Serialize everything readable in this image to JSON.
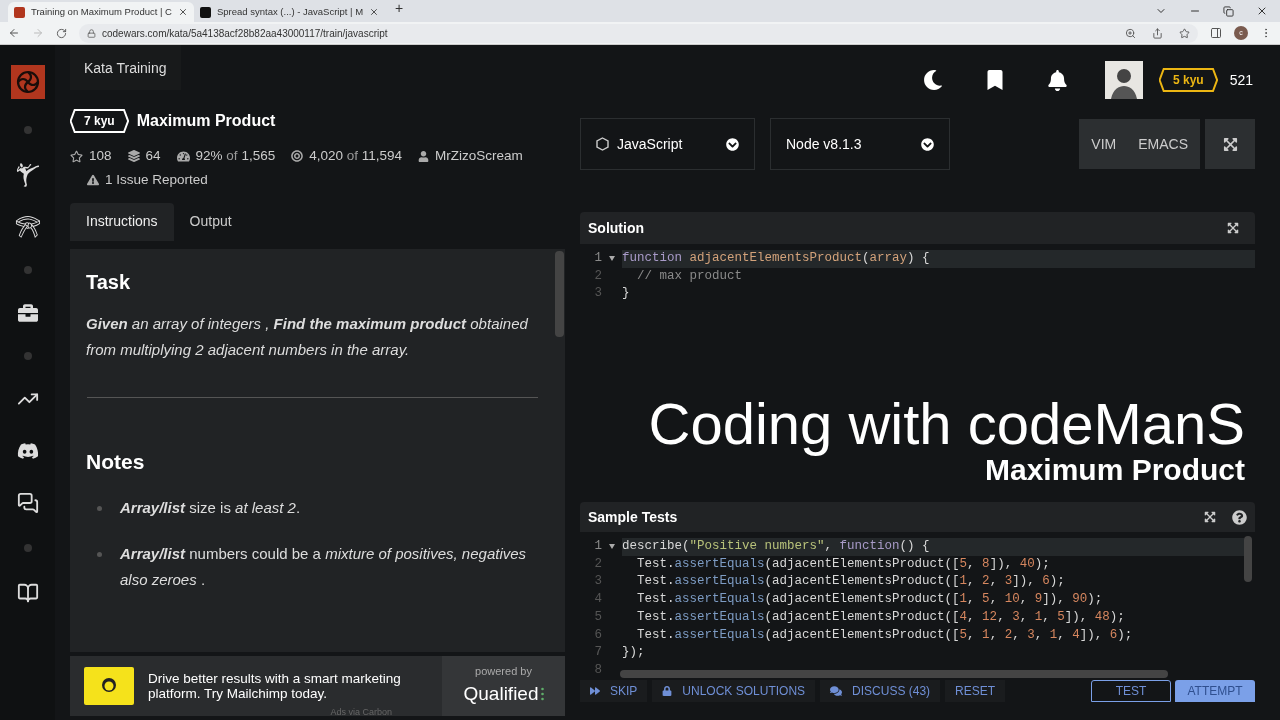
{
  "browser": {
    "tabs": [
      {
        "title": "Training on Maximum Product | C",
        "selected": true
      },
      {
        "title": "Spread syntax (...) - JavaScript | M",
        "selected": false
      }
    ],
    "new_tab": "+",
    "url": "codewars.com/kata/5a4138acf28b82aa43000117/train/javascript",
    "profile_initial": "c"
  },
  "header": {
    "section": "Kata Training",
    "rank": "5 kyu",
    "honor": "521"
  },
  "kata": {
    "rank": "7 kyu",
    "title": "Maximum Product",
    "stars": "108",
    "collections": "64",
    "satisfaction": "92%",
    "satisfaction_of": "of",
    "votes": "1,565",
    "completed": "4,020",
    "completed_of": "of",
    "attempts": "11,594",
    "author": "MrZizoScream",
    "issues": "1 Issue Reported"
  },
  "tabs": [
    {
      "label": "Instructions",
      "selected": true
    },
    {
      "label": "Output",
      "selected": false
    }
  ],
  "description": {
    "task_heading": "Task",
    "task_text": "**Given** an array of integers , **Find the maximum product** obtained from multiplying 2 adjacent numbers in the array.",
    "notes_heading": "Notes",
    "notes": [
      "**Array/list** size is *at least 2*.",
      "**Array/list** numbers could be a *mixture of positives, negatives also zeroes* ."
    ]
  },
  "ad": {
    "text": "Drive better results with a smart marketing platform. Try Mailchimp today.",
    "credit": "Ads via Carbon",
    "powered_by": "powered by",
    "platform": "Qualified"
  },
  "editor": {
    "language": "JavaScript",
    "version": "Node v8.1.3",
    "modes": [
      "VIM",
      "EMACS"
    ]
  },
  "solution": {
    "title": "Solution",
    "lines": [
      {
        "n": "1",
        "fold": true,
        "active": true,
        "tokens": [
          {
            "kind": "kw",
            "t": "function "
          },
          {
            "kind": "fn",
            "t": "adjacentElementsProduct"
          },
          {
            "kind": "plain",
            "t": "("
          },
          {
            "kind": "fn",
            "t": "array"
          },
          {
            "kind": "plain",
            "t": ") {"
          }
        ]
      },
      {
        "n": "2",
        "fold": false,
        "active": false,
        "tokens": [
          {
            "kind": "comment",
            "t": "  // max product"
          }
        ]
      },
      {
        "n": "3",
        "fold": false,
        "active": false,
        "tokens": [
          {
            "kind": "plain",
            "t": "}"
          }
        ]
      }
    ]
  },
  "overlay": {
    "title": "Coding with codeManS",
    "subtitle": "Maximum Product"
  },
  "tests": {
    "title": "Sample Tests",
    "lines": [
      {
        "n": "1",
        "fold": true,
        "active": true,
        "tokens": [
          {
            "kind": "plain",
            "t": "describe("
          },
          {
            "kind": "str",
            "t": "\"Positive numbers\""
          },
          {
            "kind": "plain",
            "t": ", "
          },
          {
            "kind": "kw",
            "t": "function"
          },
          {
            "kind": "plain",
            "t": "() {"
          }
        ]
      },
      {
        "n": "2",
        "fold": false,
        "active": false,
        "tokens": [
          {
            "kind": "plain",
            "t": "  Test."
          },
          {
            "kind": "method",
            "t": "assertEquals"
          },
          {
            "kind": "plain",
            "t": "(adjacentElementsProduct(["
          },
          {
            "kind": "num",
            "t": "5"
          },
          {
            "kind": "plain",
            "t": ", "
          },
          {
            "kind": "num",
            "t": "8"
          },
          {
            "kind": "plain",
            "t": "]), "
          },
          {
            "kind": "num",
            "t": "40"
          },
          {
            "kind": "plain",
            "t": ");"
          }
        ]
      },
      {
        "n": "3",
        "fold": false,
        "active": false,
        "tokens": [
          {
            "kind": "plain",
            "t": "  Test."
          },
          {
            "kind": "method",
            "t": "assertEquals"
          },
          {
            "kind": "plain",
            "t": "(adjacentElementsProduct(["
          },
          {
            "kind": "num",
            "t": "1"
          },
          {
            "kind": "plain",
            "t": ", "
          },
          {
            "kind": "num",
            "t": "2"
          },
          {
            "kind": "plain",
            "t": ", "
          },
          {
            "kind": "num",
            "t": "3"
          },
          {
            "kind": "plain",
            "t": "]), "
          },
          {
            "kind": "num",
            "t": "6"
          },
          {
            "kind": "plain",
            "t": ");"
          }
        ]
      },
      {
        "n": "4",
        "fold": false,
        "active": false,
        "tokens": [
          {
            "kind": "plain",
            "t": "  Test."
          },
          {
            "kind": "method",
            "t": "assertEquals"
          },
          {
            "kind": "plain",
            "t": "(adjacentElementsProduct(["
          },
          {
            "kind": "num",
            "t": "1"
          },
          {
            "kind": "plain",
            "t": ", "
          },
          {
            "kind": "num",
            "t": "5"
          },
          {
            "kind": "plain",
            "t": ", "
          },
          {
            "kind": "num",
            "t": "10"
          },
          {
            "kind": "plain",
            "t": ", "
          },
          {
            "kind": "num",
            "t": "9"
          },
          {
            "kind": "plain",
            "t": "]), "
          },
          {
            "kind": "num",
            "t": "90"
          },
          {
            "kind": "plain",
            "t": ");"
          }
        ]
      },
      {
        "n": "5",
        "fold": false,
        "active": false,
        "tokens": [
          {
            "kind": "plain",
            "t": "  Test."
          },
          {
            "kind": "method",
            "t": "assertEquals"
          },
          {
            "kind": "plain",
            "t": "(adjacentElementsProduct(["
          },
          {
            "kind": "num",
            "t": "4"
          },
          {
            "kind": "plain",
            "t": ", "
          },
          {
            "kind": "num",
            "t": "12"
          },
          {
            "kind": "plain",
            "t": ", "
          },
          {
            "kind": "num",
            "t": "3"
          },
          {
            "kind": "plain",
            "t": ", "
          },
          {
            "kind": "num",
            "t": "1"
          },
          {
            "kind": "plain",
            "t": ", "
          },
          {
            "kind": "num",
            "t": "5"
          },
          {
            "kind": "plain",
            "t": "]), "
          },
          {
            "kind": "num",
            "t": "48"
          },
          {
            "kind": "plain",
            "t": ");"
          }
        ]
      },
      {
        "n": "6",
        "fold": false,
        "active": false,
        "tokens": [
          {
            "kind": "plain",
            "t": "  Test."
          },
          {
            "kind": "method",
            "t": "assertEquals"
          },
          {
            "kind": "plain",
            "t": "(adjacentElementsProduct(["
          },
          {
            "kind": "num",
            "t": "5"
          },
          {
            "kind": "plain",
            "t": ", "
          },
          {
            "kind": "num",
            "t": "1"
          },
          {
            "kind": "plain",
            "t": ", "
          },
          {
            "kind": "num",
            "t": "2"
          },
          {
            "kind": "plain",
            "t": ", "
          },
          {
            "kind": "num",
            "t": "3"
          },
          {
            "kind": "plain",
            "t": ", "
          },
          {
            "kind": "num",
            "t": "1"
          },
          {
            "kind": "plain",
            "t": ", "
          },
          {
            "kind": "num",
            "t": "4"
          },
          {
            "kind": "plain",
            "t": "]), "
          },
          {
            "kind": "num",
            "t": "6"
          },
          {
            "kind": "plain",
            "t": ");"
          }
        ]
      },
      {
        "n": "7",
        "fold": false,
        "active": false,
        "tokens": [
          {
            "kind": "plain",
            "t": "});"
          }
        ]
      },
      {
        "n": "8",
        "fold": false,
        "active": false
      }
    ]
  },
  "actions": [
    {
      "label": "SKIP",
      "kind": "skip"
    },
    {
      "label": "UNLOCK SOLUTIONS",
      "kind": "unlock"
    },
    {
      "label": "DISCUSS (43)",
      "kind": "discuss"
    },
    {
      "label": "RESET",
      "kind": "plain"
    },
    {
      "label": "TEST",
      "kind": "outline"
    },
    {
      "label": "ATTEMPT",
      "kind": "primary"
    }
  ]
}
